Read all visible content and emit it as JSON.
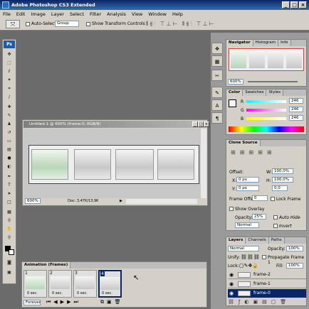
{
  "window": {
    "title": "Adobe Photoshop CS3 Extended"
  },
  "menu": [
    "File",
    "Edit",
    "Image",
    "Layer",
    "Select",
    "Filter",
    "Analysis",
    "View",
    "Window",
    "Help"
  ],
  "options": {
    "auto_select_label": "Auto-Select:",
    "auto_select_value": "Group",
    "show_transform_label": "Show Transform Controls"
  },
  "toolbox": {
    "logo": "Ps"
  },
  "document": {
    "title": "Untitled-1 @ 600% (frame-0, RGB/8)",
    "zoom": "600%",
    "doc_size": "Doc: 3,47K/13,9K"
  },
  "navigator": {
    "tabs": [
      "Navigator",
      "Histogram",
      "Info"
    ],
    "zoom": "600%"
  },
  "color": {
    "tabs": [
      "Color",
      "Swatches",
      "Styles"
    ],
    "channels": [
      {
        "label": "R",
        "value": "246"
      },
      {
        "label": "G",
        "value": "246"
      },
      {
        "label": "B",
        "value": "246"
      }
    ]
  },
  "clone_source": {
    "tab": "Clone Source",
    "offset_label": "Offset:",
    "x_label": "X:",
    "x_value": "0 px",
    "y_label": "Y:",
    "y_value": "0 px",
    "w_label": "W:",
    "w_value": "100,0%",
    "h_label": "H:",
    "h_value": "100,0%",
    "rotation": "0,0",
    "frame_offset_label": "Frame Offset:",
    "frame_offset_value": "0",
    "lock_frame_label": "Lock Frame",
    "show_overlay_label": "Show Overlay",
    "opacity_label": "Opacity:",
    "opacity_value": "25%",
    "auto_hide_label": "Auto Hide",
    "blend_value": "Normal",
    "invert_label": "Invert"
  },
  "layers": {
    "tabs": [
      "Layers",
      "Channels",
      "Paths"
    ],
    "blend_mode": "Normal",
    "opacity_label": "Opacity:",
    "opacity_value": "100%",
    "unify_label": "Unify:",
    "propagate_label": "Propagate Frame 1",
    "lock_label": "Lock:",
    "fill_label": "Fill:",
    "fill_value": "100%",
    "items": [
      {
        "name": "frame-2",
        "selected": false
      },
      {
        "name": "frame-1",
        "selected": false
      },
      {
        "name": "frame-0",
        "selected": true
      }
    ]
  },
  "animation": {
    "title": "Animation (Frames)",
    "frames": [
      {
        "num": "1",
        "delay": "0 sec."
      },
      {
        "num": "2",
        "delay": "0 sec."
      },
      {
        "num": "3",
        "delay": "0 sec."
      },
      {
        "num": "4",
        "delay": "0 sec."
      }
    ],
    "loop": "Forever"
  }
}
